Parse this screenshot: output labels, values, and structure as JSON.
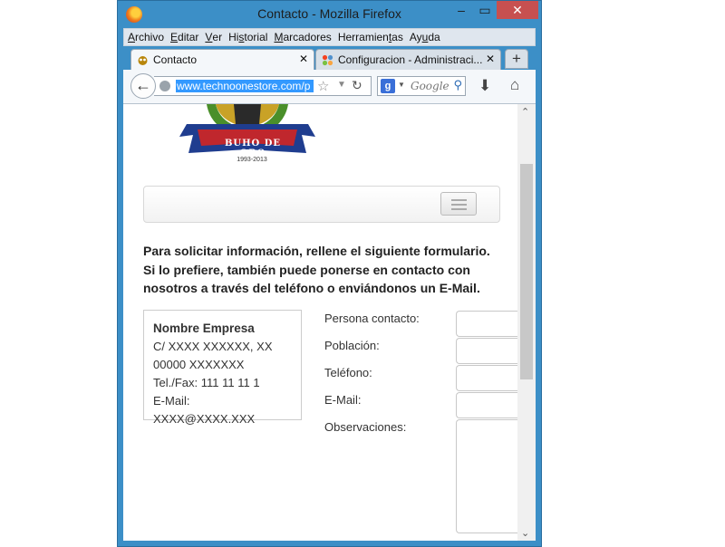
{
  "window": {
    "title": "Contacto - Mozilla Firefox",
    "minimize": "–",
    "maximize": "▭",
    "close": "✕"
  },
  "menu": {
    "items": [
      {
        "pre": "",
        "u": "A",
        "post": "rchivo"
      },
      {
        "pre": "",
        "u": "E",
        "post": "ditar"
      },
      {
        "pre": "",
        "u": "V",
        "post": "er"
      },
      {
        "pre": "Hi",
        "u": "s",
        "post": "torial"
      },
      {
        "pre": "",
        "u": "M",
        "post": "arcadores"
      },
      {
        "pre": "Herramien",
        "u": "t",
        "post": "as"
      },
      {
        "pre": "Ay",
        "u": "u",
        "post": "da"
      }
    ]
  },
  "tabs": [
    {
      "label": "Contacto",
      "close": "✕"
    },
    {
      "label": "Configuracion - Administraci...",
      "close": "✕"
    }
  ],
  "newtab": "+",
  "nav": {
    "back": "←",
    "url": "www.technoonestore.com/p",
    "star": "☆",
    "dropdown": "▼",
    "reload": "↻",
    "search_engine": "g",
    "search_placeholder": "Google",
    "search_go": "⚲",
    "download": "⬇",
    "home": "⌂"
  },
  "page": {
    "logo_text": "BUHO DE ORO",
    "logo_years": "1993-2013",
    "intro": "Para solicitar información, rellene el siguiente formulario. Si lo prefiere, también puede ponerse en contacto con nosotros  a través del teléfono o enviándonos un E-Mail.",
    "address": {
      "name": "Nombre Empresa",
      "street": "C/ XXXX XXXXXX, XX",
      "zip": "00000 XXXXXXX",
      "phone": "Tel./Fax: 111 11 11 1",
      "email": "E-Mail: XXXX@XXXX.XXX"
    },
    "form": {
      "contact_person": "Persona contacto:",
      "city": "Población:",
      "phone": "Teléfono:",
      "email": "E-Mail:",
      "notes": "Observaciones:"
    }
  },
  "scrollbar": {
    "up": "⌃",
    "down": "⌄"
  },
  "colors": {
    "frame": "#3c8fc7",
    "close_button": "#c75050",
    "url_highlight": "#3399ff"
  }
}
